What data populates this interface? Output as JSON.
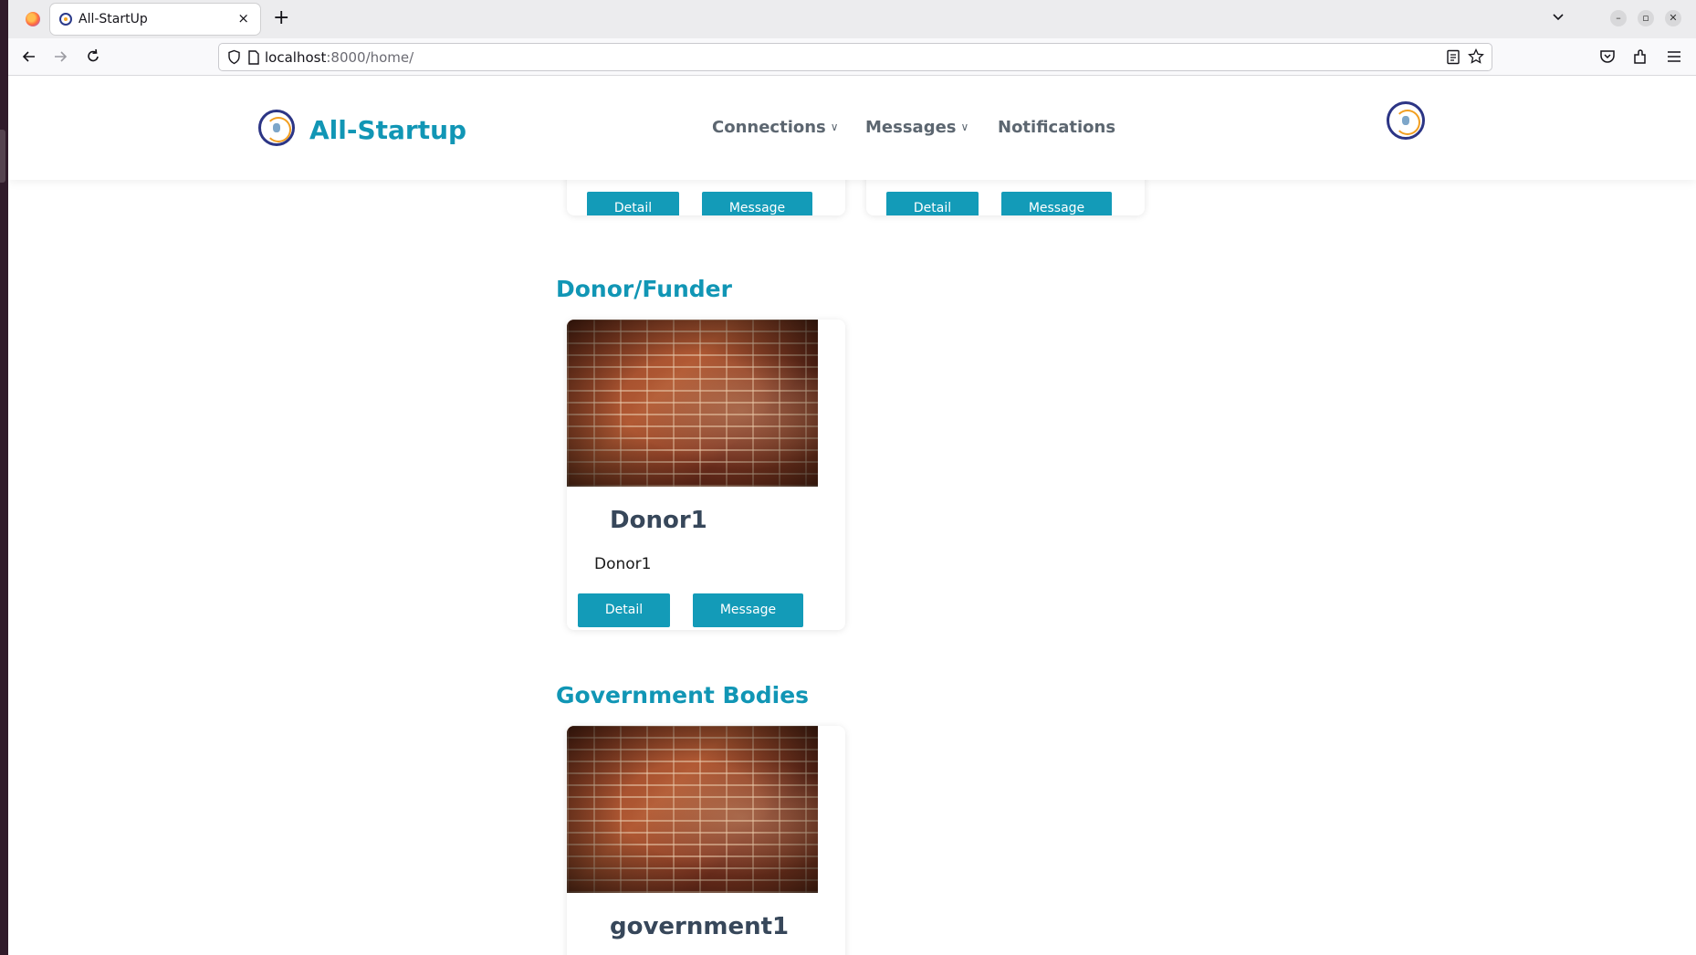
{
  "browser": {
    "tab_title": "All-StartUp",
    "tab_close": "×",
    "new_tab": "+",
    "url_host": "localhost",
    "url_path": ":8000/home/"
  },
  "header": {
    "site_name": "All-Startup",
    "menu": {
      "connections": "Connections",
      "messages": "Messages",
      "notifications": "Notifications"
    }
  },
  "top_cards": [
    {
      "detail": "Detail",
      "message": "Message"
    },
    {
      "detail": "Detail",
      "message": "Message"
    }
  ],
  "sections": {
    "donor": {
      "title": "Donor/Funder",
      "card": {
        "name": "Donor1",
        "description": "Donor1",
        "detail": "Detail",
        "message": "Message"
      }
    },
    "government": {
      "title": "Government Bodies",
      "card": {
        "name": "government1"
      }
    }
  },
  "colors": {
    "accent": "#139bb8",
    "heading": "#1196b5",
    "card_title": "#37475a"
  }
}
